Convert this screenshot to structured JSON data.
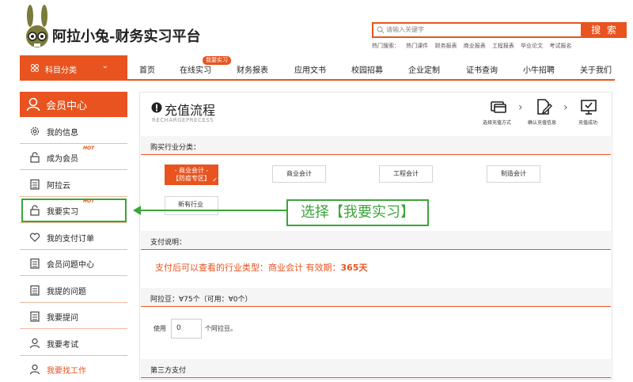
{
  "header": {
    "logo_text": "阿拉小兔",
    "logo_sub": "-财务实习平台",
    "search_placeholder": "请输入关键字",
    "search_button": "搜 索",
    "hot_label": "热门搜索：",
    "hot_terms": [
      "热门课件",
      "财务报表",
      "商业报表",
      "工程报表",
      "毕业论文",
      "考试报名"
    ]
  },
  "nav": {
    "category": "科目分类",
    "items": [
      "首页",
      "在线实习",
      "财务报表",
      "应用文书",
      "校园招募",
      "企业定制",
      "证书查询",
      "小牛招聘",
      "关于我们"
    ],
    "badge": "我要实习"
  },
  "sidebar": {
    "title": "会员中心",
    "hot": "HOT",
    "items": [
      {
        "label": "我的信息",
        "icon": "gear-icon"
      },
      {
        "label": "成为会员",
        "icon": "lock-icon"
      },
      {
        "label": "阿拉云",
        "icon": "document-icon"
      },
      {
        "label": "我要实习",
        "icon": "lock-icon"
      },
      {
        "label": "我的支付订单",
        "icon": "heart-icon"
      },
      {
        "label": "会员问题中心",
        "icon": "document-icon"
      },
      {
        "label": "我提的问题",
        "icon": "document-icon"
      },
      {
        "label": "我要提问",
        "icon": "document-icon"
      },
      {
        "label": "我要考试",
        "icon": "user-icon"
      },
      {
        "label": "我要找工作",
        "icon": "user-icon"
      }
    ]
  },
  "main": {
    "title": "充值流程",
    "subtitle": "RECHARGEPRECESS",
    "steps": [
      "选择充值方式",
      "确认充值信息",
      "充值成功"
    ],
    "sections": {
      "industry": "购买行业分类：",
      "payment": "支付说明：",
      "beans": "阿拉豆：∀75个（可用：∀0个）",
      "third_party": "第三方支付"
    },
    "industries": {
      "selected_line1": "- 商业会计 -",
      "selected_line2": "【防疫专区】",
      "others": [
        "商业会计",
        "工程会计",
        "制造会计",
        "新有行业"
      ]
    },
    "payment_text_prefix": "支付后可以查看的行业类型：商业会计 有效期：",
    "payment_days": "365天",
    "use_label": "使用",
    "use_value": "0",
    "use_unit": "个阿拉豆。"
  },
  "callout": {
    "text": "选择【我要实习】"
  },
  "colors": {
    "accent": "#e8531f",
    "highlight": "#3aa53a"
  }
}
